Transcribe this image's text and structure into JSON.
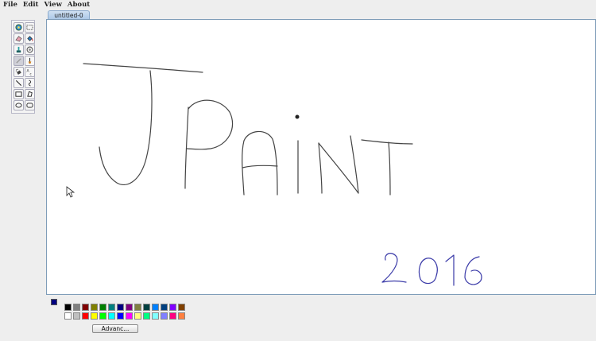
{
  "menu": [
    "File",
    "Edit",
    "View",
    "About"
  ],
  "tab": {
    "label": "untitled-0"
  },
  "tools": [
    {
      "name": "color-picker-icon"
    },
    {
      "name": "rectangle-select-icon"
    },
    {
      "name": "eraser-icon"
    },
    {
      "name": "fill-bucket-icon"
    },
    {
      "name": "stamp-icon"
    },
    {
      "name": "lasso-icon"
    },
    {
      "name": "pencil-icon"
    },
    {
      "name": "brush-icon"
    },
    {
      "name": "spray-icon"
    },
    {
      "name": "text-icon"
    },
    {
      "name": "line-icon"
    },
    {
      "name": "curve-icon"
    },
    {
      "name": "rectangle-icon"
    },
    {
      "name": "polygon-icon"
    },
    {
      "name": "ellipse-icon"
    },
    {
      "name": "rounded-rectangle-icon"
    }
  ],
  "current_color": "#000080",
  "palette_row1": [
    "#000000",
    "#808080",
    "#800000",
    "#808000",
    "#008000",
    "#008080",
    "#000080",
    "#800080",
    "#808040",
    "#004040",
    "#0080ff",
    "#004080",
    "#8000ff",
    "#804000"
  ],
  "palette_row2": [
    "#ffffff",
    "#c0c0c0",
    "#ff0000",
    "#ffff00",
    "#00ff00",
    "#00ffff",
    "#0000ff",
    "#ff00ff",
    "#ffff80",
    "#00ff80",
    "#80ffff",
    "#8080ff",
    "#ff0080",
    "#ff8040"
  ],
  "advanced_button": {
    "label": "Advanc..."
  },
  "drawing": {
    "year_text": "2016",
    "year_color": "#3a3aa8"
  }
}
